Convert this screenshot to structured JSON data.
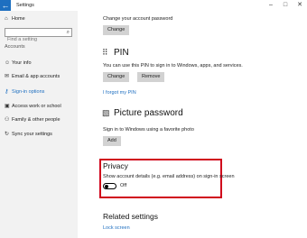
{
  "window": {
    "title": "Settings",
    "back_glyph": "←",
    "min_glyph": "–",
    "max_glyph": "□",
    "close_glyph": "✕"
  },
  "sidebar": {
    "home_label": "Home",
    "search_placeholder": "Find a setting",
    "section_label": "Accounts",
    "items": [
      {
        "label": "Your info",
        "icon": "person-icon"
      },
      {
        "label": "Email & app accounts",
        "icon": "email-icon"
      },
      {
        "label": "Sign-in options",
        "icon": "key-icon",
        "active": true
      },
      {
        "label": "Access work or school",
        "icon": "briefcase-icon"
      },
      {
        "label": "Family & other people",
        "icon": "people-icon"
      },
      {
        "label": "Sync your settings",
        "icon": "sync-icon"
      }
    ]
  },
  "password": {
    "desc": "Change your account password",
    "change_label": "Change"
  },
  "pin": {
    "heading": "PIN",
    "desc": "You can use this PIN to sign in to Windows, apps, and services.",
    "change_label": "Change",
    "remove_label": "Remove",
    "forgot_label": "I forgot my PIN"
  },
  "picture_password": {
    "heading": "Picture password",
    "desc": "Sign in to Windows using a favorite photo",
    "add_label": "Add"
  },
  "privacy": {
    "heading": "Privacy",
    "desc": "Show account details (e.g. email address) on sign-in screen",
    "toggle_state": "Off"
  },
  "related": {
    "heading": "Related settings",
    "link_label": "Lock screen"
  }
}
